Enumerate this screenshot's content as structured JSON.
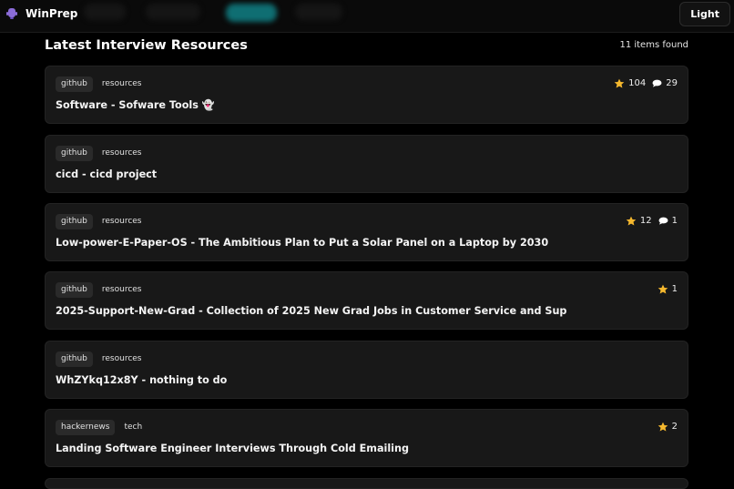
{
  "app": {
    "name": "WinPrep",
    "theme_toggle_label": "Light"
  },
  "main": {
    "title": "Latest Interview Resources",
    "count_label": "11 items found"
  },
  "colors": {
    "star": "#f5b82e",
    "logo": "#8b6cd8"
  },
  "resources": [
    {
      "source": "github",
      "category": "resources",
      "title": "Software - Sofware Tools 👻",
      "stars": "104",
      "comments": "29"
    },
    {
      "source": "github",
      "category": "resources",
      "title": "cicd - cicd project"
    },
    {
      "source": "github",
      "category": "resources",
      "title": "Low-power-E-Paper-OS - The Ambitious Plan to Put a Solar Panel on a Laptop by 2030",
      "stars": "12",
      "comments": "1"
    },
    {
      "source": "github",
      "category": "resources",
      "title": "2025-Support-New-Grad - Collection of 2025 New Grad Jobs in Customer Service and Sup",
      "stars": "1"
    },
    {
      "source": "github",
      "category": "resources",
      "title": "WhZYkq12x8Y - nothing to do"
    },
    {
      "source": "hackernews",
      "category": "tech",
      "title": "Landing Software Engineer Interviews Through Cold Emailing",
      "stars": "2"
    }
  ]
}
